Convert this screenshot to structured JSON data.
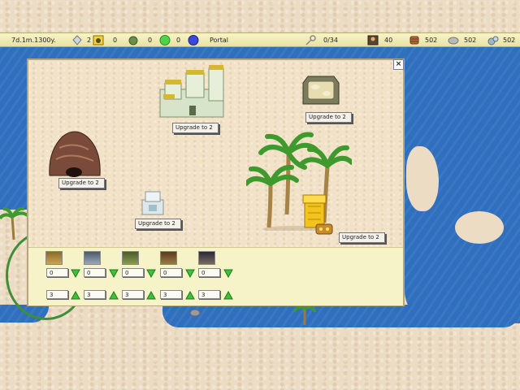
{
  "topbar": {
    "time": "7d.1m.1300y.",
    "crystal_count": "2",
    "resource_a": "0",
    "resource_b": "0",
    "resource_c": "0",
    "portal_label": "Portal",
    "capacity": "0/34",
    "units_count": "40",
    "wood": "502",
    "stone": "502",
    "ore": "502"
  },
  "dialog": {
    "close_label": "×",
    "buildings": [
      {
        "name": "castle",
        "upgrade_label": "Upgrade to 2"
      },
      {
        "name": "arena",
        "upgrade_label": "Upgrade to 2"
      },
      {
        "name": "cave",
        "upgrade_label": "Upgrade to 2"
      },
      {
        "name": "well",
        "upgrade_label": "Upgrade to 2"
      },
      {
        "name": "treasury",
        "upgrade_label": "Upgrade to 2"
      }
    ],
    "units": [
      {
        "portrait": "goblin",
        "top_value": "0",
        "bottom_value": "3"
      },
      {
        "portrait": "knight",
        "top_value": "0",
        "bottom_value": "3"
      },
      {
        "portrait": "orc",
        "top_value": "0",
        "bottom_value": "3"
      },
      {
        "portrait": "ogre",
        "top_value": "0",
        "bottom_value": "3"
      },
      {
        "portrait": "mage",
        "top_value": "0",
        "bottom_value": "3"
      }
    ]
  },
  "colors": {
    "sea": "#2f6fbe",
    "sand": "#ecdcc4",
    "panel": "#f6f3c8",
    "arrow_green": "#3fbf3a"
  }
}
